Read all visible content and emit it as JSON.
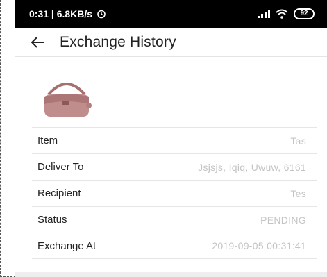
{
  "status_bar": {
    "time_speed": "0:31 | 6.8KB/s",
    "alarm_icon": "alarm-icon",
    "battery": "92"
  },
  "app_bar": {
    "back_icon": "back-arrow-icon",
    "title": "Exchange History"
  },
  "product": {
    "image_icon": "handbag-image",
    "color": "#b98383"
  },
  "details": [
    {
      "label": "Item",
      "value": "Tas"
    },
    {
      "label": "Deliver To",
      "value": "Jsjsjs, Iqiq, Uwuw, 6161"
    },
    {
      "label": "Recipient",
      "value": "Tes"
    },
    {
      "label": "Status",
      "value": "PENDING"
    },
    {
      "label": "Exchange At",
      "value": "2019-09-05 00:31:41"
    }
  ]
}
